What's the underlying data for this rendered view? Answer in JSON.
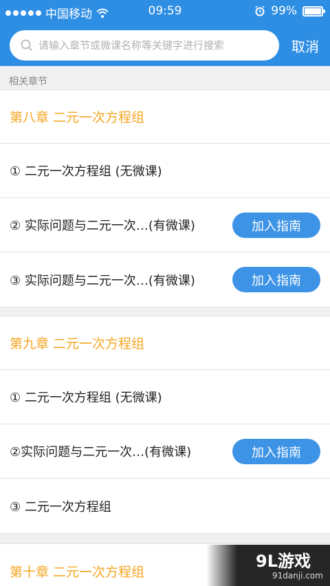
{
  "status_bar": {
    "carrier": "中国移动",
    "time": "09:59",
    "battery": "99%",
    "battery_level": 0.99
  },
  "search": {
    "placeholder": "请输入章节或微课名称等关键字进行搜索",
    "cancel_label": "取消"
  },
  "section_label": "相关章节",
  "chapters": [
    {
      "title": "第八章   二元一次方程组",
      "items": [
        {
          "label": "① 二元一次方程组 (无微课)",
          "button": ""
        },
        {
          "label": "② 实际问题与二元一次…(有微课)",
          "button": "加入指南"
        },
        {
          "label": "③ 实际问题与二元一次…(有微课)",
          "button": "加入指南"
        }
      ]
    },
    {
      "title": "第九章   二元一次方程组",
      "items": [
        {
          "label": "① 二元一次方程组 (无微课)",
          "button": ""
        },
        {
          "label": "②实际问题与二元一次…(有微课)",
          "button": "加入指南"
        },
        {
          "label": "③ 二元一次方程组",
          "button": ""
        }
      ]
    },
    {
      "title": "第十章   二元一次方程组",
      "items": []
    }
  ],
  "watermark": {
    "main": "9L游戏",
    "sub": "91danji.com"
  }
}
